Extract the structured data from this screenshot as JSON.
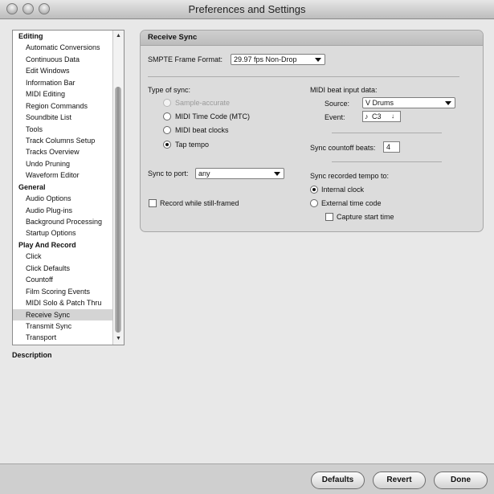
{
  "window": {
    "title": "Preferences and Settings"
  },
  "sidebar": {
    "items": [
      {
        "label": "Editing",
        "type": "category"
      },
      {
        "label": "Automatic Conversions",
        "type": "item"
      },
      {
        "label": "Continuous Data",
        "type": "item"
      },
      {
        "label": "Edit Windows",
        "type": "item"
      },
      {
        "label": "Information Bar",
        "type": "item"
      },
      {
        "label": "MIDI Editing",
        "type": "item"
      },
      {
        "label": "Region Commands",
        "type": "item"
      },
      {
        "label": "Soundbite List",
        "type": "item"
      },
      {
        "label": "Tools",
        "type": "item"
      },
      {
        "label": "Track Columns Setup",
        "type": "item"
      },
      {
        "label": "Tracks Overview",
        "type": "item"
      },
      {
        "label": "Undo Pruning",
        "type": "item"
      },
      {
        "label": "Waveform Editor",
        "type": "item"
      },
      {
        "label": "General",
        "type": "category"
      },
      {
        "label": "Audio Options",
        "type": "item"
      },
      {
        "label": "Audio Plug-ins",
        "type": "item"
      },
      {
        "label": "Background Processing",
        "type": "item"
      },
      {
        "label": "Startup Options",
        "type": "item"
      },
      {
        "label": "Play And Record",
        "type": "category"
      },
      {
        "label": "Click",
        "type": "item"
      },
      {
        "label": "Click Defaults",
        "type": "item"
      },
      {
        "label": "Countoff",
        "type": "item"
      },
      {
        "label": "Film Scoring Events",
        "type": "item"
      },
      {
        "label": "MIDI Solo & Patch Thru",
        "type": "item"
      },
      {
        "label": "Receive Sync",
        "type": "item",
        "selected": true
      },
      {
        "label": "Transmit Sync",
        "type": "item"
      },
      {
        "label": "Transport",
        "type": "item"
      }
    ]
  },
  "description_label": "Description",
  "panel": {
    "title": "Receive Sync",
    "smpte": {
      "label": "SMPTE Frame Format:",
      "value": "29.97 fps Non-Drop"
    },
    "sync_type": {
      "label": "Type of sync:",
      "options": [
        {
          "label": "Sample-accurate",
          "checked": false,
          "disabled": true
        },
        {
          "label": "MIDI Time Code (MTC)",
          "checked": false,
          "disabled": false
        },
        {
          "label": "MIDI beat clocks",
          "checked": false,
          "disabled": false
        },
        {
          "label": "Tap tempo",
          "checked": true,
          "disabled": false
        }
      ]
    },
    "sync_port": {
      "label": "Sync to port:",
      "value": "any"
    },
    "record_still": {
      "label": "Record while still-framed",
      "checked": false
    },
    "midi_beat": {
      "label": "MIDI beat input data:",
      "source_label": "Source:",
      "source_value": "V Drums",
      "event_label": "Event:",
      "event_value": "C3"
    },
    "countoff": {
      "label": "Sync countoff beats:",
      "value": "4"
    },
    "recorded_tempo": {
      "label": "Sync recorded tempo to:",
      "options": [
        {
          "label": "Internal clock",
          "checked": true
        },
        {
          "label": "External time code",
          "checked": false
        }
      ],
      "capture": {
        "label": "Capture start time",
        "checked": false
      }
    }
  },
  "buttons": {
    "defaults": "Defaults",
    "revert": "Revert",
    "done": "Done"
  }
}
